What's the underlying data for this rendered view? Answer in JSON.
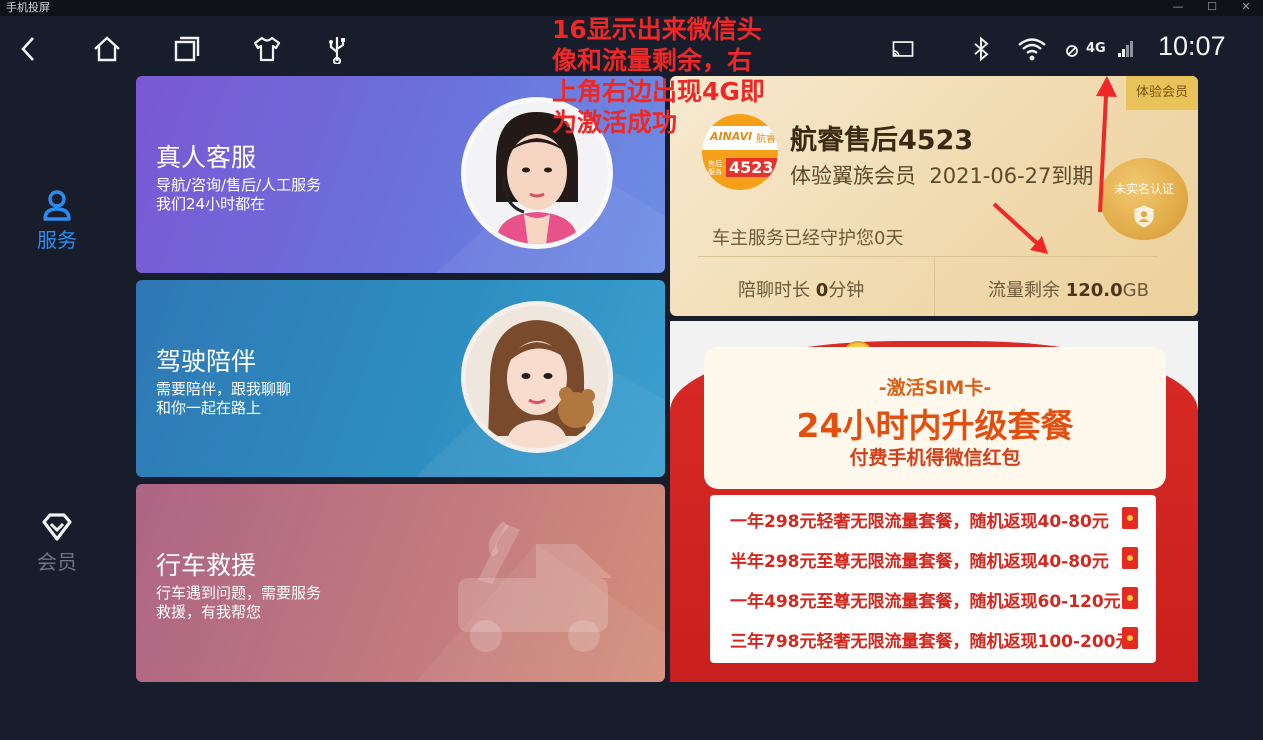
{
  "window": {
    "title": "手机投屏",
    "minimize": "—",
    "maximize": "☐",
    "close": "✕"
  },
  "statusbar": {
    "network_label": "4G",
    "time": "10:07"
  },
  "sidenav": {
    "items": [
      {
        "label": "服务",
        "icon": "user-icon",
        "active": true
      },
      {
        "label": "会员",
        "icon": "diamond-icon",
        "active": false
      }
    ]
  },
  "cards": [
    {
      "title": "真人客服",
      "subtitle_1": "导航/咨询/售后/人工服务",
      "subtitle_2": "我们24小时都在",
      "color": "#6d6ad8"
    },
    {
      "title": "驾驶陪伴",
      "subtitle_1": "需要陪伴，跟我聊聊",
      "subtitle_2": "和你一起在路上",
      "color": "#3487bf"
    },
    {
      "title": "行车救援",
      "subtitle_1": "行车遇到问题，需要服务",
      "subtitle_2": "救援，有我帮您",
      "color": "#c07a80"
    }
  ],
  "member": {
    "tag": "体验会员",
    "logo_text": "AINAVI",
    "logo_sub": "航睿",
    "logo_id": "4523",
    "logo_service": "售后服务",
    "name": "航睿售后4523",
    "plan": "体验翼族会员",
    "expiry": "2021-06-27到期",
    "guard_text": "车主服务已经守护您0天",
    "chat_label": "陪聊时长 ",
    "chat_value": "0",
    "chat_unit": "分钟",
    "data_label": "流量剩余 ",
    "data_value": "120.0",
    "data_unit": "GB",
    "badge": "未实名认证"
  },
  "promo": {
    "small": "-激活SIM卡-",
    "big": "24小时内升级套餐",
    "mid": "付费手机得微信红包",
    "offers": [
      "一年298元轻奢无限流量套餐，随机返现40-80元",
      "半年298元至尊无限流量套餐，随机返现40-80元",
      "一年498元至尊无限流量套餐，随机返现60-120元",
      "三年798元轻奢无限流量套餐，随机返现100-200元"
    ]
  },
  "annotation": {
    "line1": "16显示出来微信头",
    "line2": "像和流量剩余，右",
    "line3": "上角右边出现4G即",
    "line4": "为激活成功"
  },
  "colors": {
    "background": "#181d2b",
    "accent_blue": "#2d8cf0",
    "annotation_red": "#ee2727"
  }
}
